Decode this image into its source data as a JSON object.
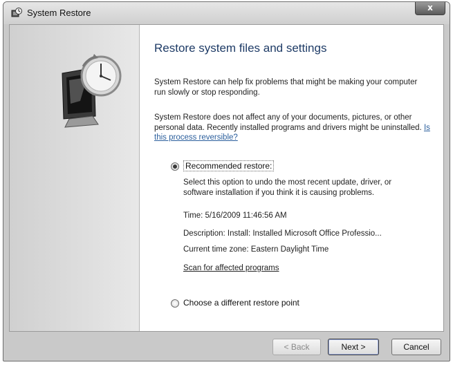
{
  "window": {
    "title": "System Restore",
    "close_label": "x"
  },
  "icons": {
    "title_icon": "system-restore-icon",
    "hero": "clock-monitor-icon",
    "close": "close-icon"
  },
  "main": {
    "heading": "Restore system files and settings",
    "paragraph1": "System Restore can help fix problems that might be making your computer run slowly or stop responding.",
    "paragraph2_text": "System Restore does not affect any of your documents, pictures, or other personal data. Recently installed programs and drivers might be uninstalled.",
    "paragraph2_link": "Is this process reversible?"
  },
  "options": {
    "recommended": {
      "label": "Recommended restore:",
      "selected": true,
      "description": "Select this option to undo the most recent update, driver, or software installation if you think it is causing problems.",
      "time": "Time: 5/16/2009 11:46:56 AM",
      "desc_line": "Description: Install: Installed Microsoft Office Professio...",
      "timezone": "Current time zone: Eastern Daylight Time",
      "scan_link": "Scan for affected programs"
    },
    "different": {
      "label": "Choose a different restore point",
      "selected": false
    }
  },
  "buttons": {
    "back": "< Back",
    "next": "Next >",
    "cancel": "Cancel"
  },
  "colors": {
    "heading": "#1e3b66",
    "link": "#2a5e9c"
  }
}
